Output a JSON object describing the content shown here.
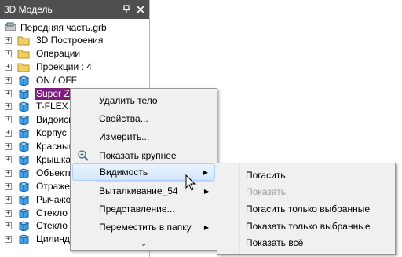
{
  "panel": {
    "title": "3D Модель",
    "pin_glyph": "ᵖ",
    "close_glyph": "✕"
  },
  "tree": {
    "root": "Передняя часть.grb",
    "items": [
      {
        "label": "3D Построения",
        "icon": "folder-icon",
        "exp": "+"
      },
      {
        "label": "Операции",
        "icon": "folder-icon",
        "exp": "+"
      },
      {
        "label": "Проекции : 4",
        "icon": "folder-icon",
        "exp": "+"
      },
      {
        "label": "ON / OFF",
        "icon": "cube-icon",
        "exp": "+"
      },
      {
        "label": "Super Zoom",
        "icon": "cube-icon",
        "exp": "+",
        "selected": true
      },
      {
        "label": "T-FLEX",
        "icon": "cube-icon",
        "exp": "+"
      },
      {
        "label": "Видоиск",
        "icon": "cube-icon",
        "exp": "+"
      },
      {
        "label": "Корпус",
        "icon": "cube-icon",
        "exp": "+"
      },
      {
        "label": "Красный",
        "icon": "cube-icon",
        "exp": "+"
      },
      {
        "label": "Крышка",
        "icon": "cube-icon",
        "exp": "+"
      },
      {
        "label": "Объекты",
        "icon": "cube-icon",
        "exp": "+"
      },
      {
        "label": "Отраже",
        "icon": "cube-icon",
        "exp": "+"
      },
      {
        "label": "Рычажо",
        "icon": "cube-icon",
        "exp": "+"
      },
      {
        "label": "Стекло",
        "icon": "cube-icon",
        "exp": "+"
      },
      {
        "label": "Стекло",
        "icon": "cube-icon",
        "exp": "+"
      },
      {
        "label": "Цилинд",
        "icon": "cube-icon",
        "exp": "+"
      }
    ]
  },
  "context_menu": {
    "items": [
      {
        "label": "Удалить тело"
      },
      {
        "label": "Свойства..."
      },
      {
        "label": "Измерить..."
      },
      {
        "label": "Показать крупнее",
        "icon": "zoom-icon"
      },
      {
        "label": "Видимость",
        "submenu": true,
        "highlighted": true
      },
      {
        "label": "Выталкивание_54",
        "submenu": true
      },
      {
        "label": "Представление..."
      },
      {
        "label": "Переместить в папку",
        "submenu": true
      }
    ],
    "more_glyph": "⌄"
  },
  "submenu": {
    "items": [
      {
        "label": "Погасить",
        "disabled": false
      },
      {
        "label": "Показать",
        "disabled": true
      },
      {
        "label": "Погасить только выбранные",
        "disabled": false
      },
      {
        "label": "Показать только выбранные",
        "disabled": false
      },
      {
        "label": "Показать всё",
        "disabled": false
      }
    ]
  },
  "colors": {
    "title_bg": "#4f4f4f",
    "selection": "#7b1e7c",
    "menu_bg": "#f0f0f0",
    "cube": "#3fa0e8",
    "folder": "#f3cf61"
  }
}
